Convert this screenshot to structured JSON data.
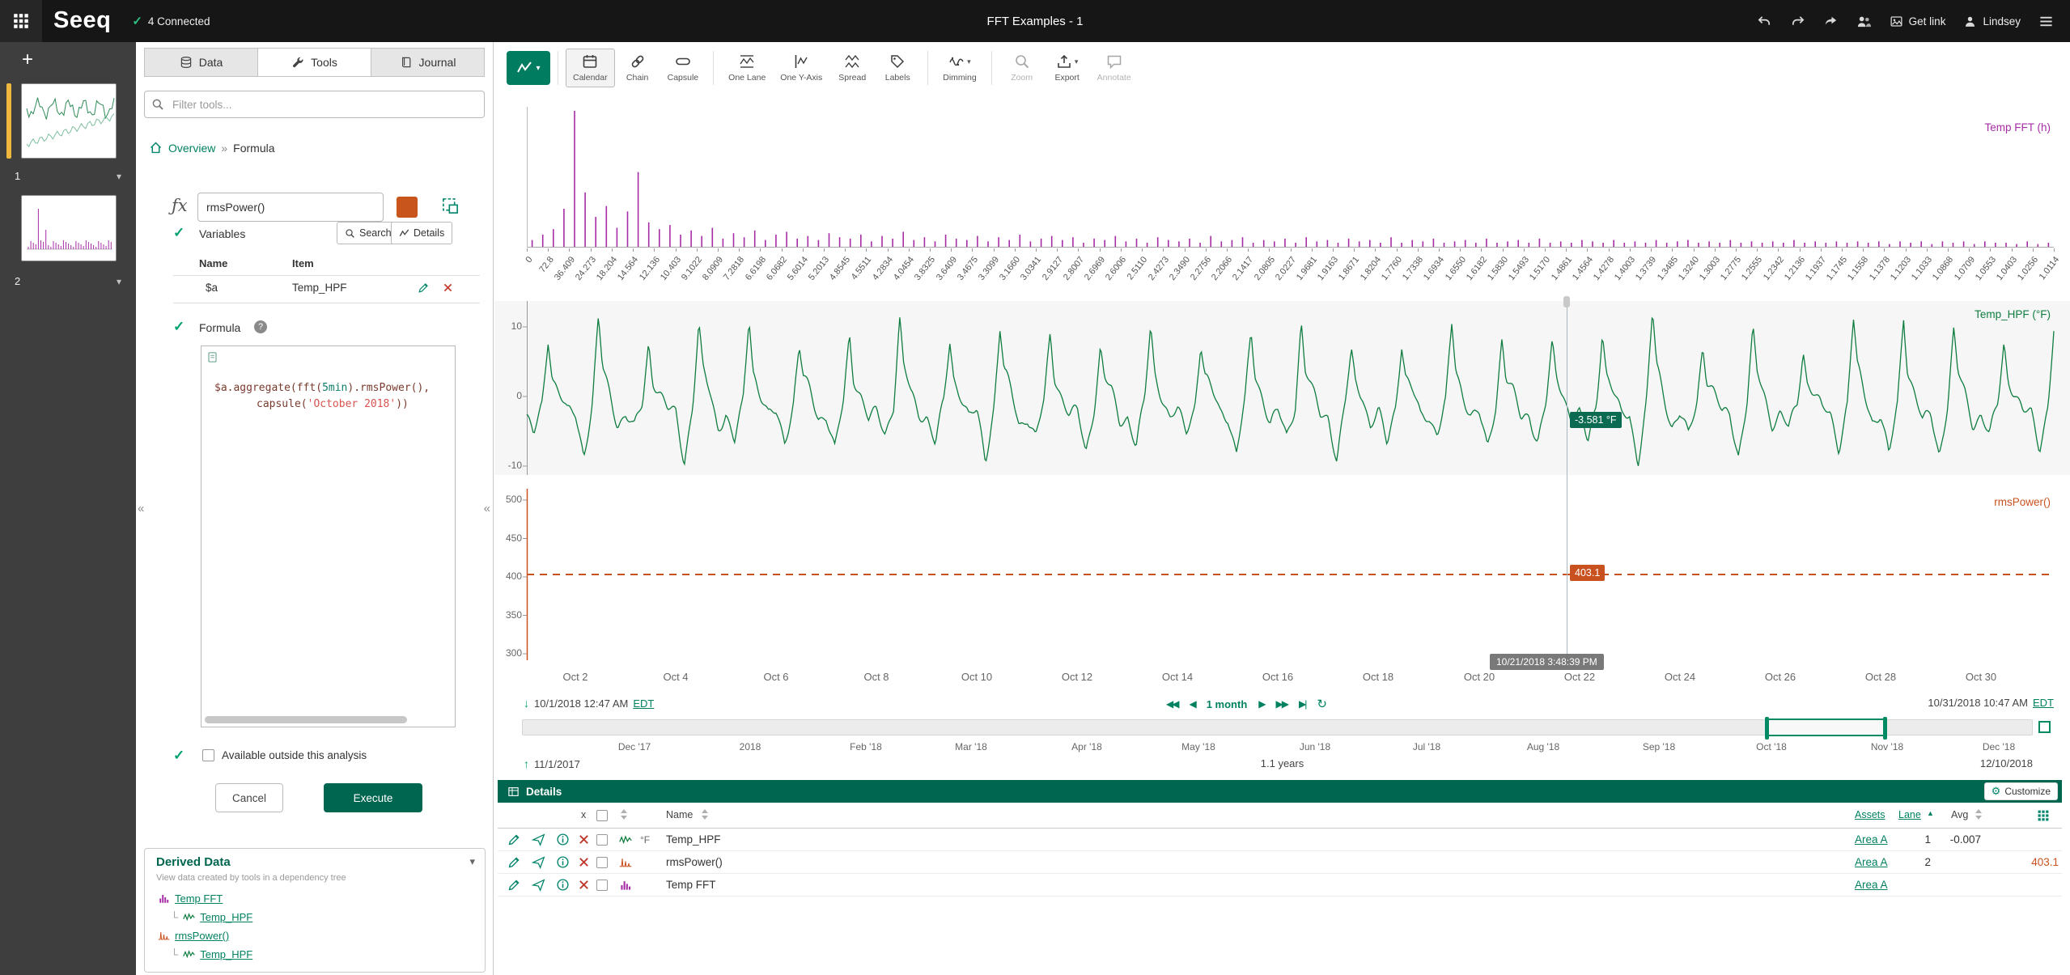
{
  "topbar": {
    "logo": "Seeq",
    "status": "4 Connected",
    "title": "FFT Examples - 1",
    "get_link": "Get link",
    "user": "Lindsey"
  },
  "worksheets": {
    "items": [
      {
        "number": "1"
      },
      {
        "number": "2"
      }
    ]
  },
  "tools_panel": {
    "tabs": [
      {
        "label": "Data"
      },
      {
        "label": "Tools"
      },
      {
        "label": "Journal"
      }
    ],
    "filter_placeholder": "Filter tools...",
    "breadcrumb": {
      "root": "Overview",
      "separator": "»",
      "current": "Formula"
    },
    "formula_tool": {
      "fx": "ƒx",
      "name_value": "rmsPower()",
      "swatch_color": "#c8551c",
      "variables_label": "Variables",
      "search_button": "Search",
      "details_button": "Details",
      "columns": {
        "name": "Name",
        "item": "Item"
      },
      "variables": [
        {
          "name": "$a",
          "item": "Temp_HPF"
        }
      ],
      "formula_label": "Formula",
      "code": [
        [
          {
            "t": "$a",
            "c": "plain"
          },
          {
            "t": ".aggregate(fft(",
            "c": "plain"
          },
          {
            "t": "5min",
            "c": "num"
          },
          {
            "t": ").rmsPower(),",
            "c": "plain"
          }
        ],
        [
          {
            "t": "capsule(",
            "c": "plain"
          },
          {
            "t": "'October 2018'",
            "c": "str"
          },
          {
            "t": "))",
            "c": "plain"
          }
        ]
      ],
      "available_label": "Available outside this analysis",
      "cancel_button": "Cancel",
      "execute_button": "Execute"
    },
    "derived_data": {
      "title": "Derived Data",
      "subtitle": "View data created by tools in a dependency tree",
      "tree": [
        {
          "label": "Temp FFT",
          "icon": "fft",
          "depth": 0
        },
        {
          "label": "Temp_HPF",
          "icon": "signal",
          "depth": 1
        },
        {
          "label": "rmsPower()",
          "icon": "rms",
          "depth": 0
        },
        {
          "label": "Temp_HPF",
          "icon": "signal",
          "depth": 1
        }
      ]
    }
  },
  "toolbar": {
    "buttons": [
      {
        "label": "Calendar",
        "icon": "calendar",
        "active": true
      },
      {
        "label": "Chain",
        "icon": "chain"
      },
      {
        "label": "Capsule",
        "icon": "capsule"
      },
      {
        "label": "One Lane",
        "icon": "one-lane",
        "sep_before": true
      },
      {
        "label": "One Y-Axis",
        "icon": "one-y-axis"
      },
      {
        "label": "Spread",
        "icon": "spread"
      },
      {
        "label": "Labels",
        "icon": "labels"
      },
      {
        "label": "Dimming",
        "icon": "dimming",
        "caret": true,
        "sep_before": true
      },
      {
        "label": "Zoom",
        "icon": "zoom",
        "enabled": false,
        "sep_before": true
      },
      {
        "label": "Export",
        "icon": "export",
        "caret": true
      },
      {
        "label": "Annotate",
        "icon": "annotate",
        "enabled": false
      }
    ]
  },
  "chart_data": [
    {
      "type": "bar",
      "title": "Temp FFT (h)",
      "color": "#a62ca6",
      "ylim": [
        0,
        100
      ],
      "x_tick_labels": [
        "0",
        "72.8",
        "36.409",
        "24.273",
        "18.204",
        "14.564",
        "12.136",
        "10.403",
        "9.1022",
        "8.0909",
        "7.2818",
        "6.6198",
        "6.0682",
        "5.6014",
        "5.2013",
        "4.8545",
        "4.5511",
        "4.2834",
        "4.0454",
        "3.8325",
        "3.6409",
        "3.4675",
        "3.3099",
        "3.1660",
        "3.0341",
        "2.9127",
        "2.8007",
        "2.6969",
        "2.6006",
        "2.5110",
        "2.4273",
        "2.3490",
        "2.2756",
        "2.2066",
        "2.1417",
        "2.0805",
        "2.0227",
        "1.9681",
        "1.9163",
        "1.8671",
        "1.8204",
        "1.7760",
        "1.7338",
        "1.6934",
        "1.6550",
        "1.6182",
        "1.5830",
        "1.5493",
        "1.5170",
        "1.4861",
        "1.4564",
        "1.4278",
        "1.4003",
        "1.3739",
        "1.3485",
        "1.3240",
        "1.3003",
        "1.2775",
        "1.2555",
        "1.2342",
        "1.2136",
        "1.1937",
        "1.1745",
        "1.1558",
        "1.1378",
        "1.1203",
        "1.1033",
        "1.0868",
        "1.0709",
        "1.0553",
        "1.0403",
        "1.0256",
        "1.0114"
      ],
      "values": [
        5,
        9,
        13,
        28,
        100,
        40,
        22,
        30,
        14,
        26,
        55,
        18,
        13,
        16,
        9,
        12,
        8,
        14,
        6,
        10,
        7,
        12,
        5,
        9,
        11,
        6,
        8,
        5,
        10,
        7,
        6,
        9,
        4,
        8,
        6,
        11,
        5,
        7,
        4,
        9,
        6,
        5,
        8,
        4,
        7,
        5,
        9,
        4,
        6,
        8,
        5,
        7,
        3,
        6,
        5,
        8,
        4,
        6,
        3,
        7,
        5,
        4,
        6,
        3,
        8,
        4,
        5,
        7,
        3,
        5,
        4,
        6,
        3,
        7,
        4,
        5,
        3,
        6,
        4,
        5,
        3,
        7,
        3,
        5,
        4,
        6,
        3,
        4,
        5,
        3,
        6,
        3,
        4,
        5,
        3,
        6,
        3,
        4,
        3,
        5,
        4,
        3,
        5,
        3,
        4,
        3,
        5,
        3,
        4,
        5,
        3,
        4,
        3,
        5,
        3,
        4,
        3,
        4,
        3,
        5,
        3,
        4,
        3,
        4,
        3,
        4,
        3,
        4,
        2,
        4,
        3,
        4,
        2,
        4,
        3,
        4,
        2,
        4,
        3,
        3,
        2,
        4,
        2,
        3
      ]
    },
    {
      "type": "line",
      "title": "Temp_HPF (°F)",
      "unit": "°F",
      "color": "#0e7d3f",
      "yticks": [
        10,
        0,
        -10
      ],
      "ylim": [
        -11,
        13.5
      ],
      "x_labels": [
        "Oct 2",
        "Oct 4",
        "Oct 6",
        "Oct 8",
        "Oct 10",
        "Oct 12",
        "Oct 14",
        "Oct 16",
        "Oct 18",
        "Oct 20",
        "Oct 22",
        "Oct 24",
        "Oct 26",
        "Oct 28",
        "Oct 30"
      ],
      "daily_peaks": [
        9,
        11,
        8,
        10,
        12,
        7,
        9,
        11,
        8,
        10,
        9,
        7,
        10,
        8,
        9,
        11,
        6,
        8,
        10,
        9,
        7,
        10,
        12,
        8,
        9,
        7,
        11,
        12,
        9,
        8,
        10
      ],
      "daily_troughs": [
        -6,
        -8,
        -5,
        -9,
        -7,
        -6,
        -8,
        -5,
        -7,
        -9,
        -6,
        -8,
        -7,
        -5,
        -8,
        -6,
        -9,
        -7,
        -5,
        -8,
        -6,
        -7,
        -9,
        -6,
        -8,
        -5,
        -7,
        -9,
        -8,
        -6,
        -7
      ],
      "cursor": {
        "frac": 0.681,
        "time_label": "10/21/2018 3:48:39 PM",
        "value": -3.581,
        "value_label": "-3.581 °F"
      }
    },
    {
      "type": "scalar",
      "title": "rmsPower()",
      "color": "#c9511f",
      "yticks": [
        500,
        450,
        400,
        350,
        300
      ],
      "ylim": [
        290,
        515
      ],
      "value": 403.1,
      "value_label": "403.1",
      "line_style": "dashed"
    }
  ],
  "range": {
    "start_date": "10/1/2018 12:47 AM",
    "start_tz": "EDT",
    "end_date": "10/31/2018 10:47 AM",
    "end_tz": "EDT",
    "duration": "1 month"
  },
  "timeline": {
    "months": [
      {
        "label": "Dec '17",
        "days": 30
      },
      {
        "label": "2018",
        "days": 61
      },
      {
        "label": "Feb '18",
        "days": 92
      },
      {
        "label": "Mar '18",
        "days": 120
      },
      {
        "label": "Apr '18",
        "days": 151
      },
      {
        "label": "May '18",
        "days": 181
      },
      {
        "label": "Jun '18",
        "days": 212
      },
      {
        "label": "Jul '18",
        "days": 242
      },
      {
        "label": "Aug '18",
        "days": 273
      },
      {
        "label": "Sep '18",
        "days": 304
      },
      {
        "label": "Oct '18",
        "days": 334
      },
      {
        "label": "Nov '18",
        "days": 365
      },
      {
        "label": "Dec '18",
        "days": 395
      }
    ],
    "total_days": 404,
    "selection": {
      "from_frac": 0.823,
      "to_frac": 0.902
    }
  },
  "investigate": {
    "start": "11/1/2017",
    "end": "12/10/2018",
    "duration": "1.1 years"
  },
  "details": {
    "title": "Details",
    "customize_label": "Customize",
    "columns": {
      "x": "x",
      "name": "Name",
      "assets": "Assets",
      "lane": "Lane",
      "avg": "Avg"
    },
    "rows": [
      {
        "unit": "°F",
        "name": "Temp_HPF",
        "icon": "signal",
        "color": "#0e7d3f",
        "assets": "Area A",
        "lane": "1",
        "avg": "-0.007",
        "avg_far": false,
        "avg_color": ""
      },
      {
        "unit": "",
        "name": "rmsPower()",
        "icon": "rms",
        "color": "#c9511f",
        "assets": "Area A",
        "lane": "2",
        "avg": "403.1",
        "avg_far": true,
        "avg_color": "#c9511f"
      },
      {
        "unit": "",
        "name": "Temp FFT",
        "icon": "fft",
        "color": "#a62ca6",
        "assets": "Area A",
        "lane": "",
        "avg": "",
        "avg_far": false,
        "avg_color": ""
      }
    ]
  }
}
